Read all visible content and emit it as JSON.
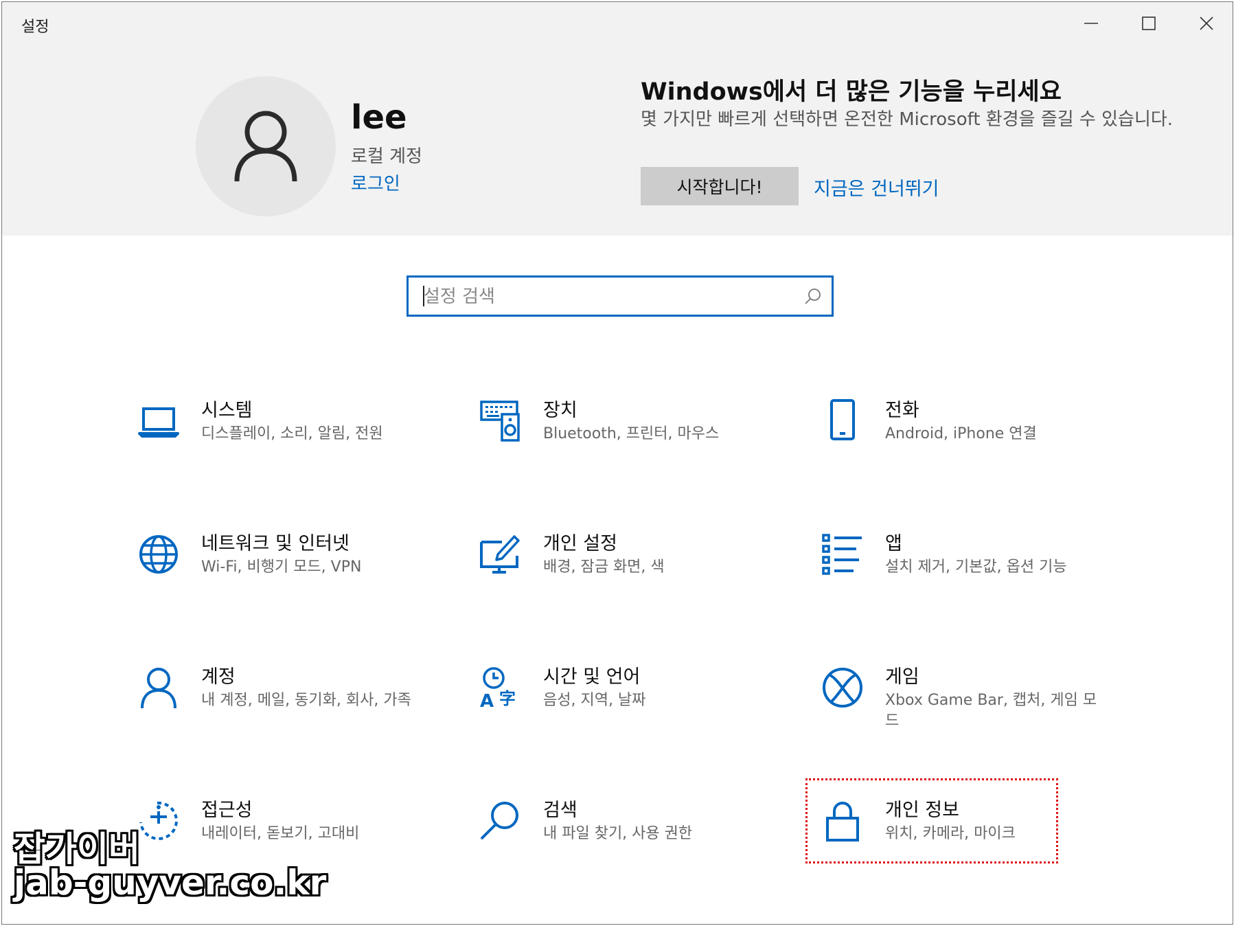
{
  "window": {
    "title": "설정"
  },
  "colors": {
    "accent": "#0067c0",
    "banner_bg": "#f2f2f2",
    "highlight": "#dd1111"
  },
  "user": {
    "name": "lee",
    "account_type": "로컬 계정",
    "login_link": "로그인",
    "avatar_icon": "person-icon"
  },
  "promo": {
    "title": "Windows에서 더 많은 기능을 누리세요",
    "description": "몇 가지만 빠르게 선택하면 온전한 Microsoft 환경을 즐길 수 있습니다.",
    "start_button": "시작합니다!",
    "skip_link": "지금은 건너뛰기"
  },
  "search": {
    "placeholder": "설정 검색",
    "icon": "search-icon"
  },
  "categories": [
    {
      "name": "시스템",
      "desc": "디스플레이, 소리, 알림, 전원",
      "icon": "laptop-icon"
    },
    {
      "name": "장치",
      "desc": "Bluetooth, 프린터, 마우스",
      "icon": "devices-icon"
    },
    {
      "name": "전화",
      "desc": "Android, iPhone 연결",
      "icon": "phone-icon"
    },
    {
      "name": "네트워크 및 인터넷",
      "desc": "Wi-Fi, 비행기 모드, VPN",
      "icon": "globe-icon"
    },
    {
      "name": "개인 설정",
      "desc": "배경, 잠금 화면, 색",
      "icon": "personalization-icon"
    },
    {
      "name": "앱",
      "desc": "설치 제거, 기본값, 옵션 기능",
      "icon": "apps-list-icon"
    },
    {
      "name": "계정",
      "desc": "내 계정, 메일, 동기화, 회사, 가족",
      "icon": "account-icon"
    },
    {
      "name": "시간 및 언어",
      "desc": "음성, 지역, 날짜",
      "icon": "time-language-icon"
    },
    {
      "name": "게임",
      "desc": "Xbox Game Bar, 캡처, 게임 모드",
      "icon": "xbox-icon"
    },
    {
      "name": "접근성",
      "desc": "내레이터, 돋보기, 고대비",
      "icon": "accessibility-icon"
    },
    {
      "name": "검색",
      "desc": "내 파일 찾기, 사용 권한",
      "icon": "magnifier-icon"
    },
    {
      "name": "개인 정보",
      "desc": "위치, 카메라, 마이크",
      "icon": "lock-icon"
    }
  ],
  "watermark": {
    "line1": "잡가이버",
    "line2": "jab-guyver.co.kr"
  }
}
